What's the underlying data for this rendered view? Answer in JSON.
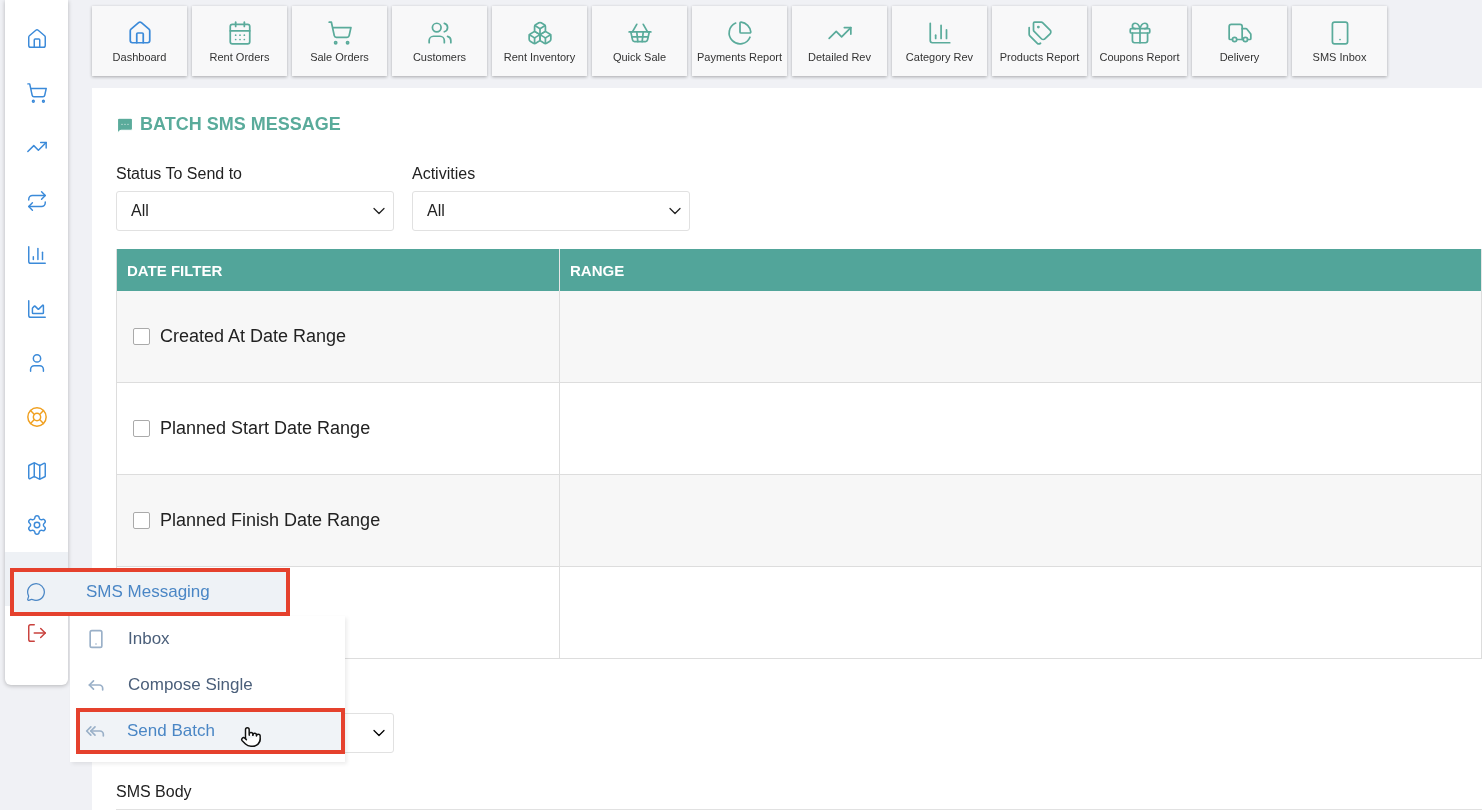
{
  "sidebar": {
    "items": [
      {
        "kind": "link",
        "selected": false
      },
      {
        "kind": "link",
        "selected": false
      },
      {
        "kind": "link",
        "selected": false
      },
      {
        "kind": "link",
        "selected": false
      },
      {
        "kind": "link",
        "selected": false
      },
      {
        "kind": "link",
        "selected": false
      },
      {
        "kind": "link",
        "selected": false
      },
      {
        "kind": "support",
        "selected": false
      },
      {
        "kind": "link",
        "selected": false
      },
      {
        "kind": "link",
        "selected": false
      },
      {
        "kind": "link",
        "selected": true
      },
      {
        "kind": "logout",
        "selected": false
      }
    ]
  },
  "toolbar": [
    "Dashboard",
    "Rent Orders",
    "Sale Orders",
    "Customers",
    "Rent Inventory",
    "Quick Sale",
    "Payments Report",
    "Detailed Rev",
    "Category Rev",
    "Products Report",
    "Coupons Report",
    "Delivery",
    "SMS Inbox"
  ],
  "flyout_menu": {
    "title": "SMS Messaging",
    "annotated": true,
    "items": [
      {
        "label": "Inbox",
        "selected": false,
        "annotated": false
      },
      {
        "label": "Compose Single",
        "selected": false,
        "annotated": false
      },
      {
        "label": "Send Batch",
        "selected": true,
        "annotated": true
      }
    ]
  },
  "page": {
    "title": "BATCH SMS MESSAGE",
    "filters": [
      {
        "label": "Status To Send to",
        "value": "All"
      },
      {
        "label": "Activities",
        "value": "All"
      }
    ],
    "table": {
      "columns": [
        "DATE FILTER",
        "RANGE"
      ],
      "rows": [
        {
          "label": "Created At Date Range",
          "checked": false
        },
        {
          "label": "Planned Start Date Range",
          "checked": false
        },
        {
          "label": "Planned Finish Date Range",
          "checked": false
        }
      ]
    },
    "body_label": "SMS Body"
  }
}
